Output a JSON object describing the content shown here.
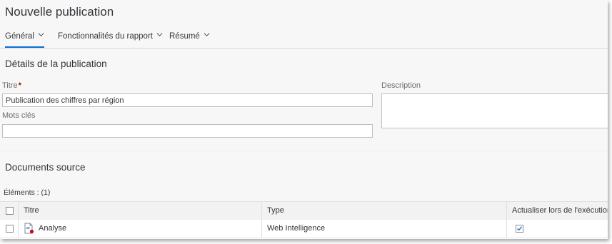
{
  "page": {
    "title": "Nouvelle publication"
  },
  "tabs": [
    {
      "label": "Général",
      "active": true
    },
    {
      "label": "Fonctionnalités du rapport",
      "active": false
    },
    {
      "label": "Résumé",
      "active": false
    }
  ],
  "details": {
    "section_title": "Détails de la publication",
    "title_label": "Titre",
    "required_marker": "*",
    "title_value": "Publication des chiffres par région",
    "keywords_label": "Mots clés",
    "keywords_value": "",
    "description_label": "Description",
    "description_value": ""
  },
  "sources": {
    "section_title": "Documents source",
    "count_label": "Éléments : (1)",
    "columns": [
      "Titre",
      "Type",
      "Actualiser lors de l'exécution"
    ],
    "rows": [
      {
        "title": "Analyse",
        "type": "Web Intelligence",
        "refresh": true,
        "selected": false,
        "icon": "webi-document-icon"
      }
    ]
  },
  "colors": {
    "accent": "#0a6ed1",
    "required": "#bb0000"
  }
}
